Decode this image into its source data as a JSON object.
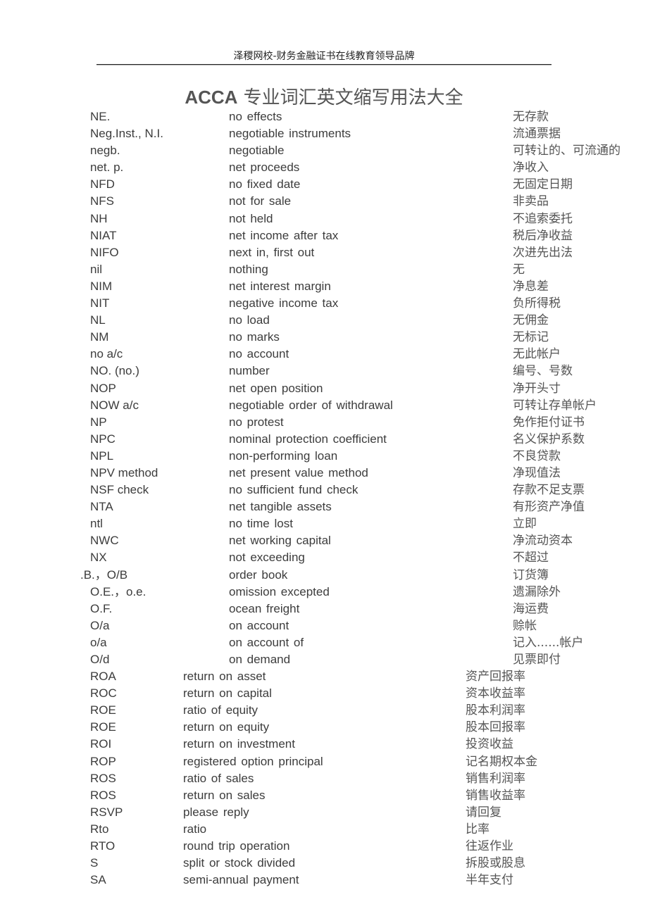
{
  "header": {
    "tagline": "泽稷网校-财务金融证书在线教育领导品牌"
  },
  "title": {
    "en": "ACCA",
    "zh": " 专业词汇英文缩写用法大全"
  },
  "entries": [
    {
      "abbr": "NE.",
      "en": "no effects",
      "zh": "无存款"
    },
    {
      "abbr": "Neg.Inst., N.I.",
      "en": "negotiable  instruments",
      "zh": "流通票据"
    },
    {
      "abbr": "negb.",
      "en": "negotiable",
      "zh": "可转让的、可流通的"
    },
    {
      "abbr": "net. p.",
      "en": "net  proceeds",
      "zh": "净收入"
    },
    {
      "abbr": "NFD",
      "en": "no  fixed date",
      "zh": "无固定日期"
    },
    {
      "abbr": "NFS",
      "en": "not  for sale",
      "zh": "非卖品"
    },
    {
      "abbr": "NH",
      "en": "not  held",
      "zh": "不追索委托"
    },
    {
      "abbr": "NIAT",
      "en": "net  income after tax",
      "zh": "税后净收益"
    },
    {
      "abbr": "NIFO",
      "en": "next  in, first out",
      "zh": "次进先出法"
    },
    {
      "abbr": "nil",
      "en": "nothing",
      "zh": "无"
    },
    {
      "abbr": "NIM",
      "en": "net  interest margin",
      "zh": "净息差"
    },
    {
      "abbr": "NIT",
      "en": "negative  income tax",
      "zh": "负所得税"
    },
    {
      "abbr": "NL",
      "en": "no  load",
      "zh": "无佣金"
    },
    {
      "abbr": "NM",
      "en": "no  marks",
      "zh": "无标记"
    },
    {
      "abbr": "no a/c",
      "en": "no  account",
      "zh": "无此帐户"
    },
    {
      "abbr": "NO. (no.)",
      "en": "number",
      "zh": "编号、号数"
    },
    {
      "abbr": "NOP",
      "en": "net  open position",
      "zh": "净开头寸"
    },
    {
      "abbr": "NOW a/c",
      "en": "negotiable  order of withdrawal",
      "zh": "可转让存单帐户"
    },
    {
      "abbr": "NP",
      "en": "no  protest",
      "zh": "免作拒付证书"
    },
    {
      "abbr": "NPC",
      "en": "nominal  protection coefficient",
      "zh": "名义保护系数"
    },
    {
      "abbr": "NPL",
      "en": "non-performing  loan",
      "zh": "不良贷款"
    },
    {
      "abbr": "NPV method",
      "en": "net  present value method",
      "zh": "净现值法"
    },
    {
      "abbr": "NSF check",
      "en": "no  sufficient fund check",
      "zh": "存款不足支票"
    },
    {
      "abbr": "NTA",
      "en": "net  tangible assets",
      "zh": "有形资产净值"
    },
    {
      "abbr": "ntl",
      "en": "no  time lost",
      "zh": "立即"
    },
    {
      "abbr": "NWC",
      "en": "net  working capital",
      "zh": "净流动资本"
    },
    {
      "abbr": "NX",
      "en": "not  exceeding",
      "zh": "不超过"
    },
    {
      "abbr": ".B.，O/B",
      "en": "order  book",
      "zh": "订货簿"
    },
    {
      "abbr": "O.E.，o.e.",
      "en": "omission  excepted",
      "zh": "遗漏除外"
    },
    {
      "abbr": "O.F.",
      "en": "ocean  freight",
      "zh": "海运费"
    },
    {
      "abbr": "O/a",
      "en": "on  account",
      "zh": "赊帐"
    },
    {
      "abbr": "o/a",
      "en": "on  account of",
      "zh": "记入......帐户"
    },
    {
      "abbr": "O/d",
      "en": "on  demand",
      "zh": "见票即付"
    },
    {
      "abbr": "ROA",
      "en": "return on  asset",
      "zh": "资产回报率"
    },
    {
      "abbr": "ROC",
      "en": "return  on capital",
      "zh": "资本收益率"
    },
    {
      "abbr": "ROE",
      "en": "ratio  of equity",
      "zh": "股本利润率"
    },
    {
      "abbr": "ROE",
      "en": "return  on equity",
      "zh": "股本回报率"
    },
    {
      "abbr": "ROI",
      "en": "return  on investment",
      "zh": "投资收益"
    },
    {
      "abbr": "ROP",
      "en": "registered  option principal",
      "zh": "记名期权本金"
    },
    {
      "abbr": "ROS",
      "en": "ratio  of sales",
      "zh": "销售利润率"
    },
    {
      "abbr": "ROS",
      "en": "return  on sales",
      "zh": "销售收益率"
    },
    {
      "abbr": "RSVP",
      "en": "please  reply",
      "zh": "请回复"
    },
    {
      "abbr": "Rto",
      "en": "ratio",
      "zh": "比率"
    },
    {
      "abbr": "RTO",
      "en": "round  trip operation",
      "zh": "往返作业"
    },
    {
      "abbr": "S",
      "en": "split  or stock divided",
      "zh": "拆股或股息"
    },
    {
      "abbr": "SA",
      "en": "semi-annual  payment",
      "zh": "半年支付"
    }
  ]
}
